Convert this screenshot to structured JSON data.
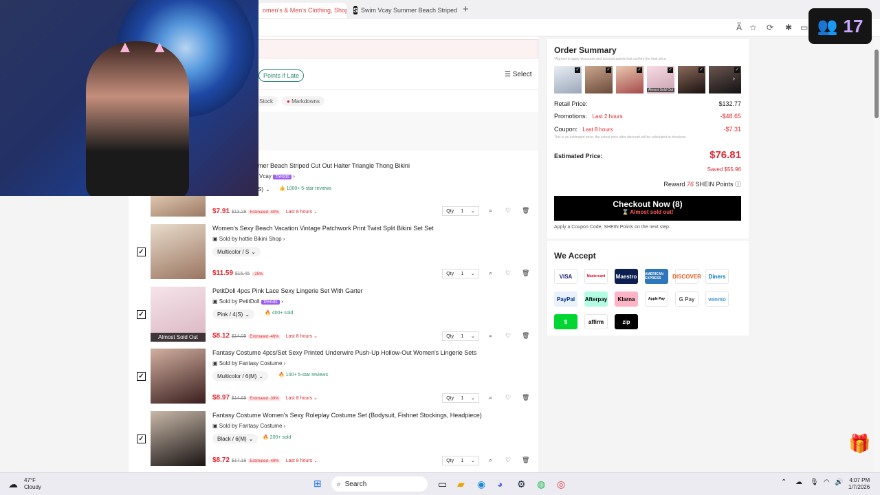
{
  "browser": {
    "tabs": [
      {
        "label": "omen's & Men's Clothing, Shop"
      },
      {
        "label": "Swim Vcay Summer Beach Striped",
        "favicon": "S"
      }
    ]
  },
  "stream": {
    "viewers": "17"
  },
  "page": {
    "late_badge": "Points if Late",
    "select_label": "Select",
    "chips": [
      "Stock",
      "Markdowns"
    ],
    "partial_item": {
      "title": "mer Beach Striped Cut Out Halter Triangle Thong Bikini",
      "seller": "Vcay",
      "trend": "Trends",
      "attr": "S)",
      "social": "1000+ 5-star reviews",
      "price": "$7.91",
      "orig": "$13.29",
      "est": "Estimated -40%",
      "last": "Last 8 hours",
      "qty_label": "Qty",
      "qty": "1"
    },
    "items": [
      {
        "title": "Women's Sexy Beach Vacation Vintage Patchwork Print Twist Split Bikini Set Set",
        "seller": "Sold by hottie Bikini Shop",
        "trend": "",
        "attr": "Multicolor / S",
        "social": "",
        "price": "$11.59",
        "orig": "$15.45",
        "est": "-25%",
        "last": "",
        "qty_label": "Qty",
        "qty": "1",
        "sold": ""
      },
      {
        "title": "PetitDoll 4pcs Pink Lace Sexy Lingerie Set With Garter",
        "seller": "Sold by PetitDoll",
        "trend": "Trends",
        "attr": "Pink / 4(S)",
        "social": "400+ sold",
        "price": "$8.12",
        "orig": "$14.09",
        "est": "Estimated -46%",
        "last": "Last 8 hours",
        "qty_label": "Qty",
        "qty": "1",
        "sold": "Almost Sold Out"
      },
      {
        "title": "Fantasy Costume 4pcs/Set Sexy Printed Underwire Push-Up Hollow-Out Women's Lingerie Sets",
        "seller": "Sold by Fantasy Costume",
        "trend": "",
        "attr": "Multicolor / 6(M)",
        "social": "100+ 5-star reviews",
        "price": "$8.97",
        "orig": "$14.69",
        "est": "Estimated -39%",
        "last": "Last 8 hours",
        "qty_label": "Qty",
        "qty": "1",
        "sold": ""
      },
      {
        "title": "Fantasy Costume Women's Sexy Roleplay Costume Set (Bodysuit, Fishnet Stockings, Headpiece)",
        "seller": "Sold by Fantasy Costume",
        "trend": "",
        "attr": "Black / 6(M)",
        "social": "200+ sold",
        "price": "$8.72",
        "orig": "$17.19",
        "est": "Estimated -49%",
        "last": "Last 8 hours",
        "qty_label": "Qty",
        "qty": "1",
        "sold": ""
      }
    ]
  },
  "summary": {
    "title": "Order Summary",
    "note": "*Agreed to apply discounts and account assets that confirm the final price.",
    "thumb_label": "Almost Sold Out",
    "retail_label": "Retail Price:",
    "retail": "$132.77",
    "promo_label": "Promotions:",
    "promo_time": "Last 2 hours",
    "promo": "-$48.65",
    "coupon_label": "Coupon:",
    "coupon_time": "Last 8 hours",
    "coupon": "-$7.31",
    "disclaimer": "This is an estimated price, the actual price after discount will be calculated at checkout.",
    "est_label": "Estimated Price:",
    "est": "$76.81",
    "saved": "Saved $55.96",
    "reward_pre": "Reward",
    "reward_pts": "76",
    "reward_post": "SHEIN Points",
    "checkout": "Checkout Now (8)",
    "checkout_sub": "Almost sold out!",
    "apply_note": "Apply a Coupon Code, SHEIN Points on the next step."
  },
  "accept": {
    "title": "We Accept",
    "methods": [
      "VISA",
      "Mastercard",
      "Maestro",
      "AMERICAN EXPRESS",
      "DISCOVER",
      "Diners",
      "PayPal",
      "Afterpay",
      "Klarna",
      "Apple Pay",
      "G Pay",
      "venmo",
      "$",
      "affirm",
      "zip"
    ]
  },
  "taskbar": {
    "temp": "47°F",
    "weather": "Cloudy",
    "search": "Search",
    "time": "4:07 PM",
    "date": "1/7/2026"
  },
  "colors": {
    "accent": "#e0262e",
    "trends": "#9b5cf5",
    "green": "#2a8a6a"
  }
}
